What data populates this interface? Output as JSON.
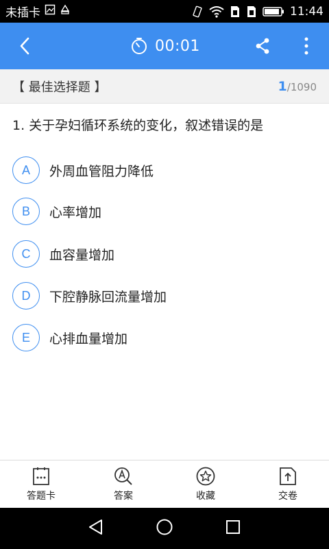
{
  "status": {
    "carrier": "未插卡",
    "time": "11:44"
  },
  "header": {
    "timer": "00:01"
  },
  "section": {
    "title": "【 最佳选择题 】",
    "current": "1",
    "total": "/1090"
  },
  "question": {
    "text": "1. 关于孕妇循环系统的变化，叙述错误的是",
    "options": [
      {
        "letter": "A",
        "text": "外周血管阻力降低"
      },
      {
        "letter": "B",
        "text": "心率增加"
      },
      {
        "letter": "C",
        "text": "血容量增加"
      },
      {
        "letter": "D",
        "text": "下腔静脉回流量增加"
      },
      {
        "letter": "E",
        "text": "心排血量增加"
      }
    ]
  },
  "tabs": [
    {
      "label": "答题卡",
      "icon": "answer-card-icon"
    },
    {
      "label": "答案",
      "icon": "answer-search-icon"
    },
    {
      "label": "收藏",
      "icon": "star-icon"
    },
    {
      "label": "交卷",
      "icon": "submit-icon"
    }
  ],
  "colors": {
    "accent": "#3e8ef0"
  }
}
